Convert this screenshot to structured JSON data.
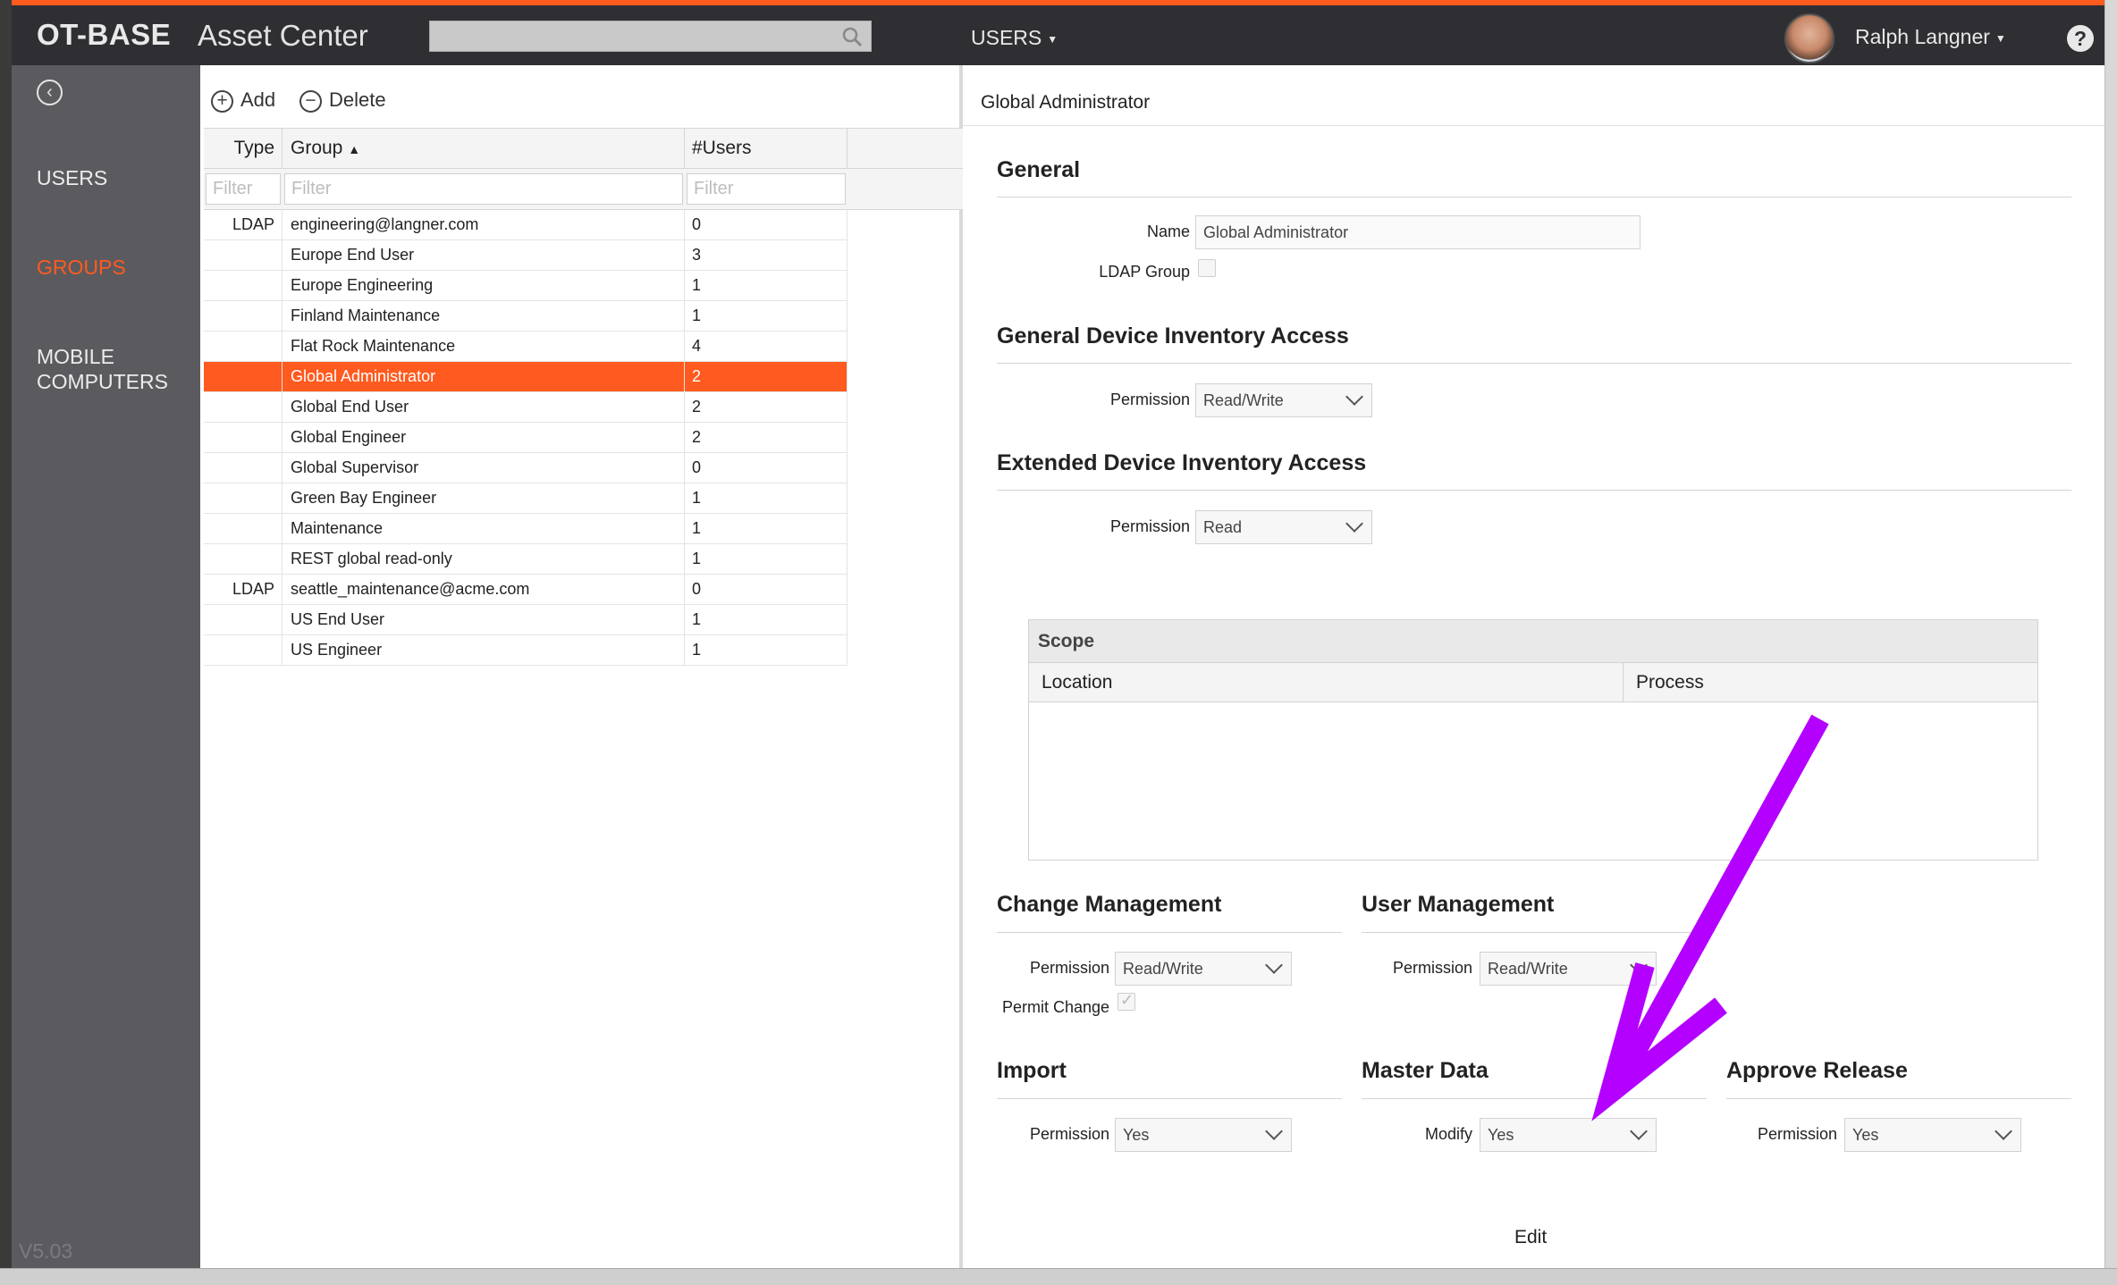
{
  "header": {
    "logo": "OT-BASE",
    "app_name": "Asset Center",
    "search_placeholder": "",
    "menu_label": "USERS",
    "user_name": "Ralph Langner",
    "help": "?"
  },
  "sidebar": {
    "items": [
      {
        "label": "USERS",
        "active": false
      },
      {
        "label": "GROUPS",
        "active": true
      },
      {
        "label": "MOBILE COMPUTERS",
        "active": false
      }
    ],
    "version": "V5.03"
  },
  "list": {
    "toolbar": {
      "add_label": "Add",
      "delete_label": "Delete"
    },
    "columns": {
      "type": "Type",
      "group": "Group",
      "users": "#Users"
    },
    "filter_placeholder": "Filter",
    "rows": [
      {
        "type": "LDAP",
        "group": "engineering@langner.com",
        "users": "0"
      },
      {
        "type": "",
        "group": "Europe End User",
        "users": "3"
      },
      {
        "type": "",
        "group": "Europe Engineering",
        "users": "1"
      },
      {
        "type": "",
        "group": "Finland Maintenance",
        "users": "1"
      },
      {
        "type": "",
        "group": "Flat Rock Maintenance",
        "users": "4"
      },
      {
        "type": "",
        "group": "Global Administrator",
        "users": "2",
        "selected": true
      },
      {
        "type": "",
        "group": "Global End User",
        "users": "2"
      },
      {
        "type": "",
        "group": "Global Engineer",
        "users": "2"
      },
      {
        "type": "",
        "group": "Global Supervisor",
        "users": "0"
      },
      {
        "type": "",
        "group": "Green Bay Engineer",
        "users": "1"
      },
      {
        "type": "",
        "group": "Maintenance",
        "users": "1"
      },
      {
        "type": "",
        "group": "REST global read-only",
        "users": "1"
      },
      {
        "type": "LDAP",
        "group": "seattle_maintenance@acme.com",
        "users": "0"
      },
      {
        "type": "",
        "group": "US End User",
        "users": "1"
      },
      {
        "type": "",
        "group": "US Engineer",
        "users": "1"
      }
    ]
  },
  "detail": {
    "title": "Global Administrator",
    "general": {
      "title": "General",
      "name_label": "Name",
      "name_value": "Global Administrator",
      "ldap_label": "LDAP Group"
    },
    "general_device": {
      "title": "General Device Inventory Access",
      "permission_label": "Permission",
      "permission_value": "Read/Write"
    },
    "extended_device": {
      "title": "Extended Device Inventory Access",
      "permission_label": "Permission",
      "permission_value": "Read"
    },
    "scope": {
      "title": "Scope",
      "col_location": "Location",
      "col_process": "Process"
    },
    "change_mgmt": {
      "title": "Change Management",
      "permission_label": "Permission",
      "permission_value": "Read/Write",
      "permit_label": "Permit Change"
    },
    "user_mgmt": {
      "title": "User Management",
      "permission_label": "Permission",
      "permission_value": "Read/Write"
    },
    "import": {
      "title": "Import",
      "permission_label": "Permission",
      "permission_value": "Yes"
    },
    "master_data": {
      "title": "Master Data",
      "modify_label": "Modify",
      "modify_value": "Yes"
    },
    "approve_release": {
      "title": "Approve Release",
      "permission_label": "Permission",
      "permission_value": "Yes"
    },
    "edit_label": "Edit"
  },
  "colors": {
    "accent": "#ff5a1f",
    "topbar": "#2f2f33",
    "sidebar": "#5b5b5f",
    "annotation_arrow": "#b400ff"
  }
}
